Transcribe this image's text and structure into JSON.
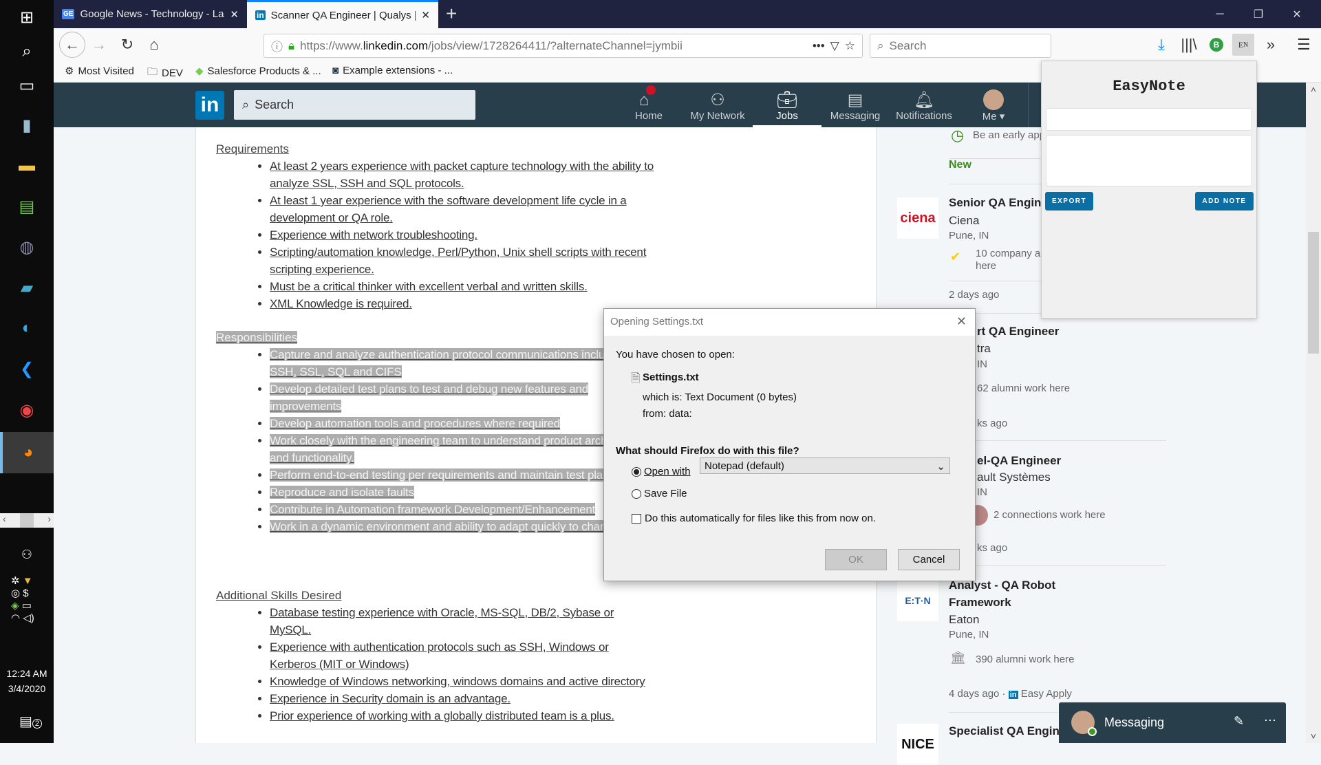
{
  "taskbar": {
    "icons": [
      "windows-start",
      "search",
      "task-view",
      "app-database",
      "file-explorer",
      "app-excel-like",
      "eclipse",
      "powershell",
      "edge",
      "vscode",
      "chrome",
      "firefox"
    ],
    "clock_time": "12:24 AM",
    "clock_date": "3/4/2020",
    "notification_count": "2"
  },
  "tabs": [
    {
      "label": "Google News - Technology - La",
      "favicon": "GE",
      "active": false
    },
    {
      "label": "Scanner QA Engineer | Qualys |",
      "favicon": "in",
      "active": true
    }
  ],
  "url": {
    "prefix": "https://www.",
    "domain": "linkedin.com",
    "path": "/jobs/view/1728264411/?alternateChannel=jymbii"
  },
  "search_placeholder": "Search",
  "bookmarks": [
    "Most Visited",
    "DEV",
    "Salesforce Products & ...",
    "Example extensions - ..."
  ],
  "linkedin": {
    "search_placeholder": "Search",
    "nav": [
      "Home",
      "My Network",
      "Jobs",
      "Messaging",
      "Notifications",
      "Me"
    ],
    "active_nav": "Jobs",
    "brand_color": "#283e4a"
  },
  "job": {
    "requirements_title": "Requirements",
    "requirements": [
      "At least 2 years experience with packet capture technology with the ability to analyze SSL, SSH and SQL protocols.",
      "At least 1 year experience with the software development life cycle in a development or QA role.",
      "Experience with network troubleshooting.",
      "Scripting/automation knowledge, Perl/Python, Unix shell scripts with recent scripting experience.",
      "Must be a critical thinker with excellent verbal and written skills.",
      "XML Knowledge is required."
    ],
    "responsibilities_title": "Responsibilities",
    "responsibilities": [
      "Capture and analyze authentication protocol communications including SSH, SSL, SQL and CIFS",
      "Develop detailed test plans to test and debug new features and improvements",
      "Develop automation tools and procedures where required",
      "Work closely with the engineering team to understand product architecture and functionality.",
      "Perform end-to-end testing per requirements and maintain test plans.",
      "Reproduce and isolate faults",
      "Contribute in Automation framework Development/Enhancement",
      "Work in a dynamic environment and ability to adapt quickly to changes."
    ],
    "skills_title": "Additional Skills Desired",
    "skills": [
      "Database testing experience with Oracle, MS-SQL, DB/2, Sybase or MySQL.",
      "Experience with authentication protocols such as SSH, Windows or Kerberos (MIT or Windows)",
      "Knowledge of Windows networking, windows domains and active directory",
      "Experience in Security domain is an advantage.",
      "Prior experience of working with a globally distributed team is a plus."
    ]
  },
  "rail": {
    "early": "Be an early app",
    "new": "New",
    "jobs": [
      {
        "title": "Senior QA Engine",
        "company": "Ciena",
        "location": "Pune, IN",
        "insight": "10 company al",
        "insight2": "here",
        "age": "2 days ago",
        "logo": "ciena"
      },
      {
        "title": "rt QA Engineer",
        "company": "tra",
        "location": "IN",
        "insight": "62 alumni work here",
        "age": "ks ago"
      },
      {
        "title": "el-QA Engineer",
        "company": "ault Systèmes",
        "location": "IN",
        "insight": "2 connections work here",
        "age": "ks ago"
      },
      {
        "title": "Analyst - QA Robot",
        "title2": "Framework",
        "company": "Eaton",
        "location": "Pune, IN",
        "insight": "390 alumni work here",
        "age": "4 days ago ·",
        "easy_apply": "Easy Apply",
        "logo": "E:T·N"
      },
      {
        "title": "Specialist QA Engine",
        "logo": "NICE"
      }
    ]
  },
  "dialog": {
    "title": "Opening Settings.txt",
    "chosen": "You have chosen to open:",
    "filename": "Settings.txt",
    "which_is_label": "which is:",
    "which_is": "Text Document (0 bytes)",
    "from_label": "from:",
    "from": "data:",
    "question": "What should Firefox do with this file?",
    "open_with": "Open with",
    "app": "Notepad (default)",
    "save_file": "Save File",
    "auto": "Do this automatically for files like this from now on.",
    "ok": "OK",
    "cancel": "Cancel",
    "selected_option": "open_with",
    "auto_checked": false
  },
  "easynote": {
    "title": "EasyNote",
    "export": "EXPORT",
    "add_note": "ADD NOTE",
    "title_value": "",
    "note_value": ""
  },
  "messaging": {
    "label": "Messaging"
  }
}
